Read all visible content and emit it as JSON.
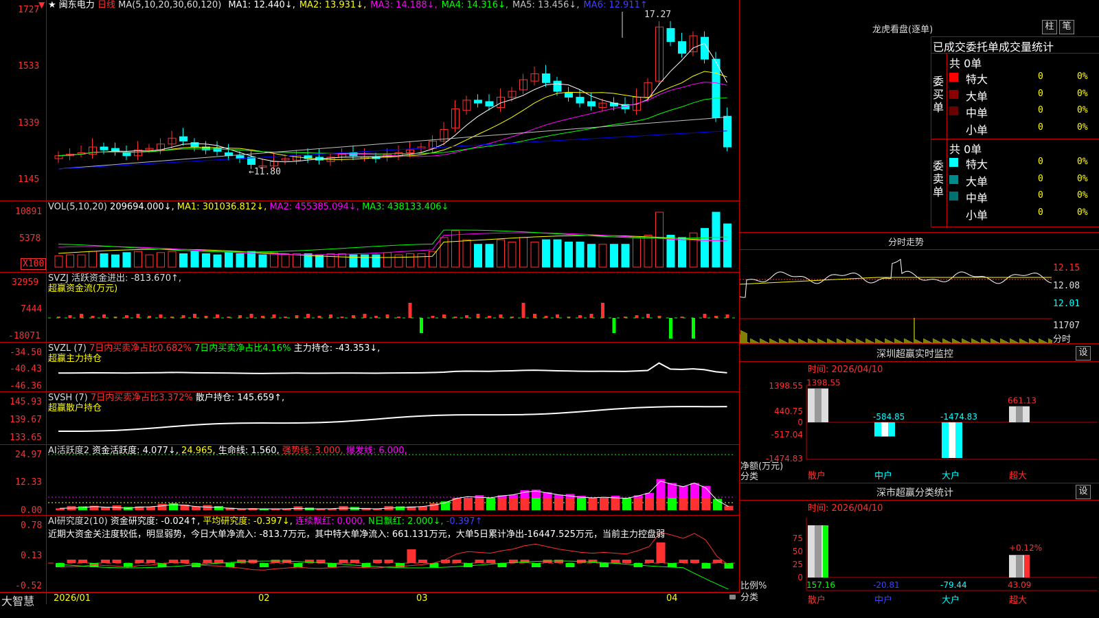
{
  "stock": {
    "star": "★",
    "name": "闽东电力",
    "period": "日线"
  },
  "colors": {
    "up": "#ff3030",
    "down": "#00ffff",
    "ma1": "#ffffff",
    "ma2": "#ffff00",
    "ma3": "#ff00ff",
    "ma4": "#00ff00",
    "ma5": "#c0c0c0",
    "ma6": "#0000ff",
    "grid": "#c00000"
  },
  "main": {
    "ma_label": "MA(5,10,20,30,60,120)",
    "ma": [
      {
        "t": "MA1: 12.440↓,",
        "c": "#ffffff"
      },
      {
        "t": "MA2: 13.931↓,",
        "c": "#ffff00"
      },
      {
        "t": "MA3: 14.188↓,",
        "c": "#ff00ff"
      },
      {
        "t": "MA4: 14.316↓,",
        "c": "#00ff00"
      },
      {
        "t": "MA5: 13.456↓,",
        "c": "#c0c0c0"
      },
      {
        "t": "MA6: 12.911↑",
        "c": "#4040ff"
      }
    ],
    "yticks": [
      "1727",
      "1533",
      "1339",
      "1145"
    ],
    "high_label": "17.27",
    "low_label": "←11.80"
  },
  "vol": {
    "header": "VOL(5,10,20)",
    "value": "209694.000↓,",
    "ma": [
      {
        "t": "MA1: 301036.812↓,",
        "c": "#ffff00"
      },
      {
        "t": "MA2: 455385.094↓,",
        "c": "#ff00ff"
      },
      {
        "t": "MA3: 438133.406↓",
        "c": "#00ff00"
      }
    ],
    "yticks": [
      "10891",
      "5378"
    ],
    "unit": "X100"
  },
  "svzj": {
    "header": "SVZJ  活跃资金进出: -813.670↑,",
    "sub": "超赢资金流(万元)",
    "yticks": [
      "32959",
      "7444",
      "-18071"
    ]
  },
  "svzl": {
    "header": "SVZL (7)",
    "h2": "7日内买卖净占比0.682%",
    "h3": "7日内买卖净占比4.16%",
    "h4": "主力持仓: -43.353↓,",
    "sub": "超赢主力持仓",
    "yticks": [
      "-34.50",
      "-40.43",
      "-46.36"
    ]
  },
  "svsh": {
    "header": "SVSH (7)",
    "h2": "7日内买卖净占比3.372%",
    "h3": "散户持仓: 145.659↑,",
    "sub": "超赢散户持仓",
    "yticks": [
      "145.93",
      "139.67",
      "133.65"
    ]
  },
  "ai1": {
    "header": "AI活跃度2",
    "h2": "资金活跃度: 4.077↓,",
    "h3": "24.965,",
    "h4": "生命线: 1.560,",
    "h5": "强势线: 3.000,",
    "h6": "爆发线: 6.000,",
    "yticks": [
      "24.97",
      "12.33",
      "0.00"
    ]
  },
  "ai2": {
    "header": "AI研究度2(10)",
    "h2": "资金研究度: -0.024↑,",
    "h3": "平均研究度: -0.397↓,",
    "h4": "连续飘红: 0.000,",
    "h5": "N日飘红: 2.000↓,",
    "h6": "-0.397↑",
    "text": "近期大资金关注度较低，明显弱势，今日大单净流入: -813.7万元，其中特大单净流入: 661.131万元，大单5日累计净出-16447.525万元，当前主力控盘弱",
    "yticks": [
      "0.78",
      "0.13",
      "-0.52"
    ]
  },
  "xaxis": {
    "labels": [
      "2026/01",
      "02",
      "03",
      "04"
    ]
  },
  "brand": "大智慧",
  "dragon": {
    "title": "龙虎看盘(逐单)",
    "btn1": "柱",
    "btn2": "笔",
    "tabs": "已成交委托单成交量统计",
    "buy_label": "委买单",
    "sell_label": "委卖单",
    "buy_total": "共 0单",
    "sell_total": "共 0单",
    "rows": [
      {
        "name": "特大",
        "v": "0",
        "p": "0%"
      },
      {
        "name": "大单",
        "v": "0",
        "p": "0%"
      },
      {
        "name": "中单",
        "v": "0",
        "p": "0%"
      },
      {
        "name": "小单",
        "v": "0",
        "p": "0%"
      }
    ]
  },
  "intraday": {
    "title": "分时走势",
    "p1": "12.15",
    "p2": "12.08",
    "p3": "12.01",
    "vol": "11707",
    "unit": "分时"
  },
  "monitor": {
    "title": "深圳超赢实时监控",
    "btn": "设",
    "time": "时间: 2026/04/10",
    "yticks": [
      "1398.55",
      "440.75",
      "0",
      "-517.04",
      "-1474.83"
    ],
    "ylabel1": "净额(万元)",
    "ylabel2": "分类",
    "cats": [
      "散户",
      "中户",
      "大户",
      "超大"
    ],
    "values": [
      1398.55,
      -584.85,
      -1474.83,
      661.13
    ],
    "value_labels": [
      "1398.55",
      "-584.85",
      "-1474.83",
      "661.13"
    ]
  },
  "classify": {
    "title": "深市超赢分类统计",
    "btn": "设",
    "time": "时间: 2026/04/10",
    "yticks": [
      "75",
      "50",
      "25",
      "0"
    ],
    "ylabel1": "比例%",
    "ylabel2": "分类",
    "cats": [
      "散户",
      "中户",
      "大户",
      "超大"
    ],
    "values": [
      157.16,
      -20.81,
      -79.44,
      43.09
    ],
    "value_labels": [
      "157.16",
      "-20.81",
      "-79.44",
      "43.09"
    ],
    "pct_label": "+0.12%"
  }
}
